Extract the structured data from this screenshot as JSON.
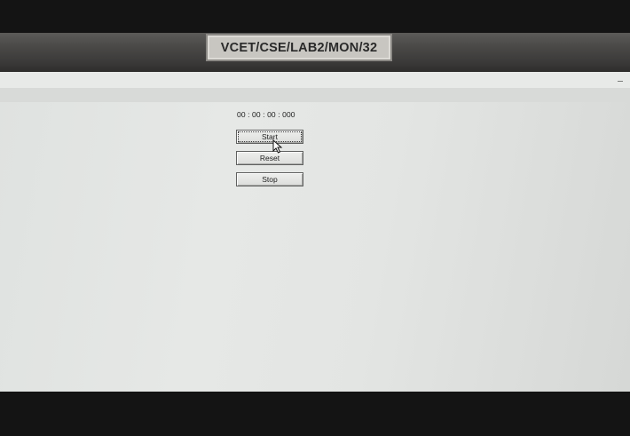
{
  "monitor": {
    "asset_label": "VCET/CSE/LAB2/MON/32"
  },
  "stopwatch": {
    "time_display": "00 : 00 : 00 : 000",
    "buttons": {
      "start": "Start",
      "reset": "Reset",
      "stop": "Stop"
    }
  }
}
